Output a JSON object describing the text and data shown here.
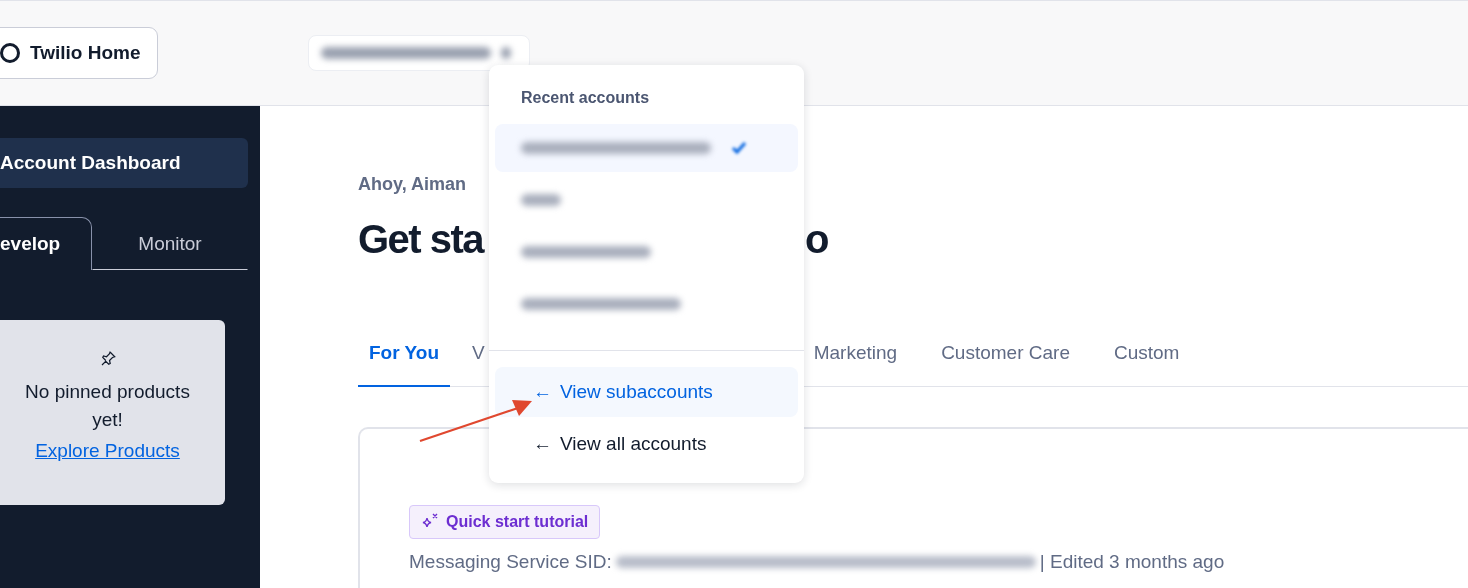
{
  "header": {
    "home_button": "Twilio Home",
    "account_switcher": {
      "expanded": true
    }
  },
  "sidebar": {
    "active_item": "Account Dashboard",
    "tabs": [
      {
        "label": "evelop",
        "selected": true
      },
      {
        "label": "Monitor",
        "selected": false
      }
    ],
    "pinned": {
      "message": "No pinned products yet!",
      "link": "Explore Products"
    }
  },
  "main": {
    "greeting": "Ahoy, Aiman",
    "heading_parts": [
      "Get sta",
      "o"
    ],
    "tabs": [
      {
        "label": "For You",
        "selected": true,
        "kind": "full"
      },
      {
        "label": "V",
        "selected": false,
        "kind": "covered"
      },
      {
        "label": "Marketing",
        "selected": false,
        "kind": "full"
      },
      {
        "label": "Customer Care",
        "selected": false,
        "kind": "full"
      },
      {
        "label": "Custom",
        "selected": false,
        "kind": "full"
      }
    ],
    "card": {
      "badge": "Quick start tutorial",
      "sid_label": "Messaging Service SID:",
      "edited": "| Edited 3 months ago"
    }
  },
  "dropdown": {
    "title": "Recent accounts",
    "accounts": [
      {
        "selected": true
      },
      {
        "selected": false
      },
      {
        "selected": false
      },
      {
        "selected": false
      }
    ],
    "actions": [
      {
        "icon": "←",
        "label": "View subaccounts",
        "selected": true
      },
      {
        "icon": "←",
        "label": "View all accounts",
        "selected": false
      }
    ]
  }
}
